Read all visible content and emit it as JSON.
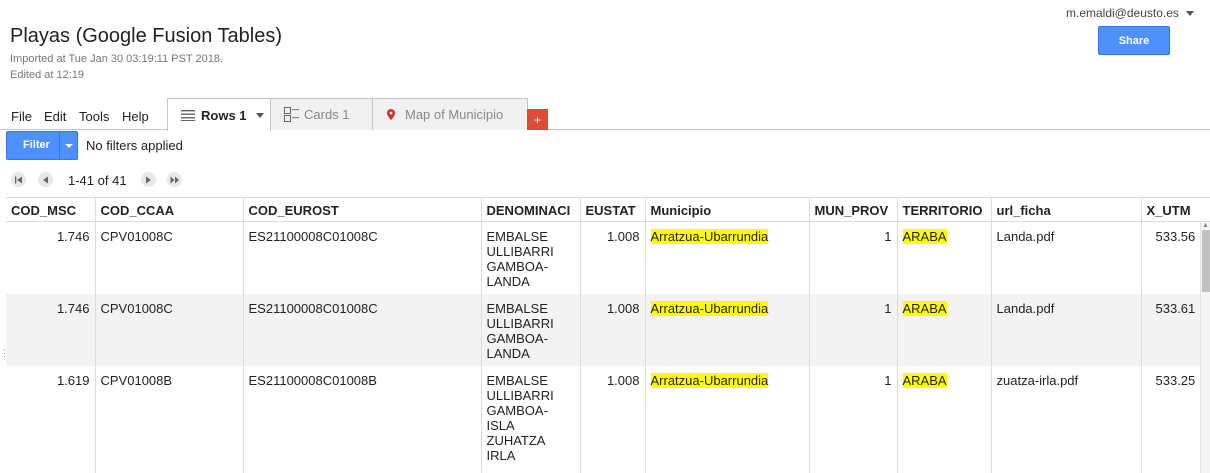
{
  "header": {
    "title": "Playas (Google Fusion Tables)",
    "imported": "Imported at Tue Jan 30 03:19:11 PST 2018.",
    "edited": "Edited at 12:19",
    "account": "m.emaldi@deusto.es",
    "share_label": "Share"
  },
  "menu": {
    "file": "File",
    "edit": "Edit",
    "tools": "Tools",
    "help": "Help"
  },
  "tabs": {
    "rows": "Rows 1",
    "cards": "Cards 1",
    "map": "Map of Municipio",
    "add": "+"
  },
  "filter": {
    "label": "Filter",
    "status": "No filters applied"
  },
  "pager": {
    "range": "1-41 of 41"
  },
  "table": {
    "columns": [
      "COD_MSC",
      "COD_CCAA",
      "COD_EUROST",
      "DENOMINACI",
      "EUSTAT",
      "Municipio",
      "MUN_PROV",
      "TERRITORIO",
      "url_ficha",
      "X_UTM"
    ],
    "rows": [
      {
        "cod_msc": "1.746",
        "cod_ccaa": "CPV01008C",
        "cod_eurost": "ES21100008C01008C",
        "denom": [
          "EMBALSE",
          "ULLIBARRI",
          "GAMBOA-",
          "LANDA"
        ],
        "eustat": "1.008",
        "municipio": "Arratzua-Ubarrundia",
        "mun_prov": "1",
        "territorio": "ARABA",
        "url_ficha": "Landa.pdf",
        "x_utm": "533.56"
      },
      {
        "cod_msc": "1.746",
        "cod_ccaa": "CPV01008C",
        "cod_eurost": "ES21100008C01008C",
        "denom": [
          "EMBALSE",
          "ULLIBARRI",
          "GAMBOA-",
          "LANDA"
        ],
        "eustat": "1.008",
        "municipio": "Arratzua-Ubarrundia",
        "mun_prov": "1",
        "territorio": "ARABA",
        "url_ficha": "Landa.pdf",
        "x_utm": "533.61"
      },
      {
        "cod_msc": "1.619",
        "cod_ccaa": "CPV01008B",
        "cod_eurost": "ES21100008C01008B",
        "denom": [
          "EMBALSE",
          "ULLIBARRI",
          "GAMBOA-",
          "ISLA",
          "ZUHATZA",
          "IRLA"
        ],
        "eustat": "1.008",
        "municipio": "Arratzua-Ubarrundia",
        "mun_prov": "1",
        "territorio": "ARABA",
        "url_ficha": "zuatza-irla.pdf",
        "x_utm": "533.25"
      }
    ]
  }
}
